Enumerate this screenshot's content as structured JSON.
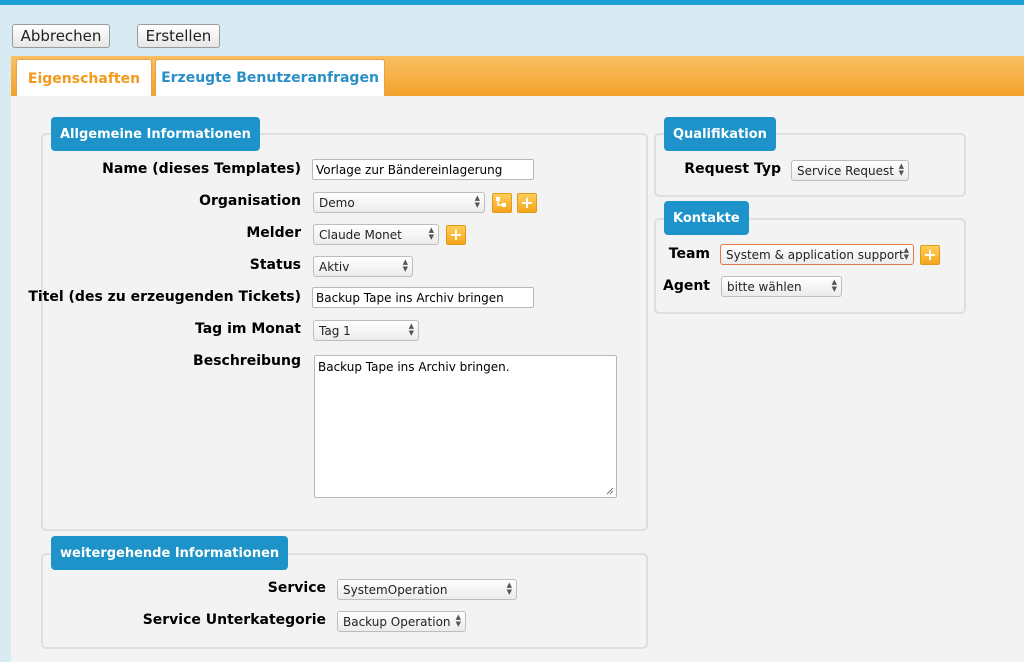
{
  "toolbar": {
    "cancel_label": "Abbrechen",
    "create_label": "Erstellen"
  },
  "tabs": {
    "properties": "Eigenschaften",
    "generated_requests": "Erzeugte Benutzeranfragen"
  },
  "general": {
    "legend": "Allgemeine Informationen",
    "name_label": "Name (dieses Templates)",
    "name_value": "Vorlage zur Bändereinlagerung",
    "organisation_label": "Organisation",
    "organisation_value": "Demo",
    "caller_label": "Melder",
    "caller_value": "Claude Monet",
    "status_label": "Status",
    "status_value": "Aktiv",
    "title_label": "Titel (des zu erzeugenden Tickets)",
    "title_value": "Backup Tape ins Archiv bringen",
    "day_label": "Tag im Monat",
    "day_value": "Tag 1",
    "description_label": "Beschreibung",
    "description_value": "Backup Tape ins Archiv bringen."
  },
  "more": {
    "legend": "weitergehende Informationen",
    "service_label": "Service",
    "service_value": "SystemOperation",
    "subcategory_label": "Service Unterkategorie",
    "subcategory_value": "Backup Operation"
  },
  "qualification": {
    "legend": "Qualifikation",
    "request_type_label": "Request Typ",
    "request_type_value": "Service Request"
  },
  "contacts": {
    "legend": "Kontakte",
    "team_label": "Team",
    "team_value": "System & application support",
    "agent_label": "Agent",
    "agent_value": "bitte wählen"
  },
  "icons": {
    "add": "plus-icon",
    "hierarchy": "hierarchy-icon",
    "select_arrows": "updown-arrows-icon",
    "resize": "resize-grip-icon"
  },
  "colors": {
    "accent_blue": "#1d93c9",
    "tab_orange": "#f4a22a",
    "active_tab_text": "#f39a1c",
    "inactive_tab_text": "#2a8fc7",
    "invalid_border": "#e07a4a"
  }
}
